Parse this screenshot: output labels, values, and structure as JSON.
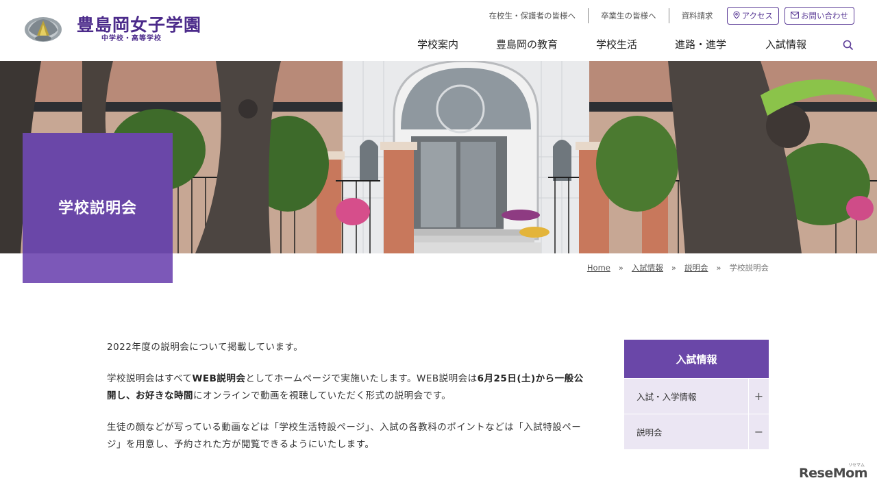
{
  "header": {
    "logo_main": "豊島岡女子学園",
    "logo_sub": "中学校・高等学校",
    "util_links": [
      "在校生・保護者の皆様へ",
      "卒業生の皆様へ",
      "資料請求"
    ],
    "access_label": "アクセス",
    "contact_label": "お問い合わせ",
    "nav": [
      "学校案内",
      "豊島岡の教育",
      "学校生活",
      "進路・進学",
      "入試情報"
    ]
  },
  "hero": {
    "title": "学校説明会"
  },
  "breadcrumb": {
    "home": "Home",
    "level1": "入試情報",
    "level2": "説明会",
    "current": "学校説明会",
    "separator": "»"
  },
  "content": {
    "p1": "2022年度の説明会について掲載しています。",
    "p2_a": "学校説明会はすべて",
    "p2_b": "WEB説明会",
    "p2_c": "としてホームページで実施いたします。WEB説明会は",
    "p2_d": "6月25日(土)から一般公開し、お好きな時間",
    "p2_e": "にオンラインで動画を視聴していただく形式の説明会です。",
    "p3": "生徒の顔などが写っている動画などは「学校生活特設ページ」、入試の各教科のポイントなどは「入試特設ページ」を用意し、予約された方が閲覧できるようにいたします。"
  },
  "side_nav": {
    "heading": "入試情報",
    "items": [
      {
        "label": "入試・入学情報",
        "toggle": "+"
      },
      {
        "label": "説明会",
        "toggle": "−"
      }
    ]
  },
  "watermark": {
    "text": "ReseMom",
    "ruby": "リセマム"
  },
  "colors": {
    "brand_purple": "#6a47a8",
    "side_item_bg": "#ebe6f3"
  }
}
